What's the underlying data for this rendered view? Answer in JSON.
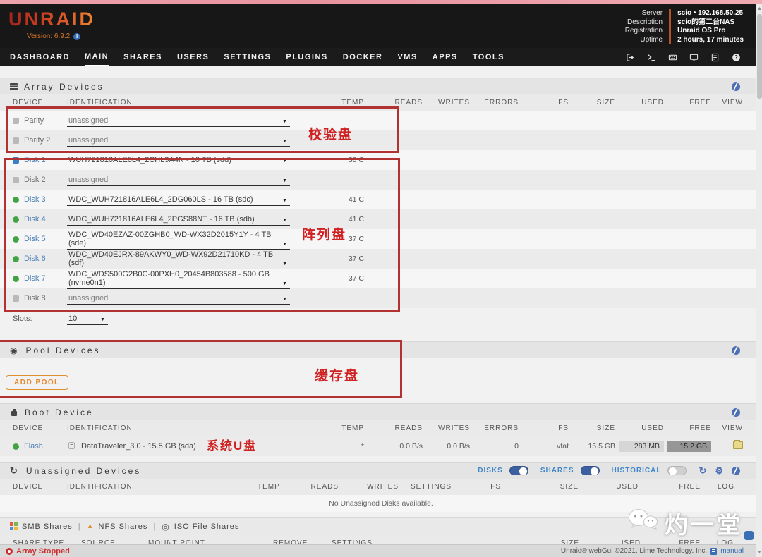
{
  "header": {
    "logo": "UNRAID",
    "version_label": "Version: 6.9.2",
    "info_rows": [
      {
        "label": "Server",
        "value": "scio • 192.168.50.25"
      },
      {
        "label": "Description",
        "value": "scio的第二台NAS"
      },
      {
        "label": "Registration",
        "value": "Unraid OS Pro"
      },
      {
        "label": "Uptime",
        "value": "2 hours, 17 minutes"
      }
    ]
  },
  "nav": {
    "items": [
      "DASHBOARD",
      "MAIN",
      "SHARES",
      "USERS",
      "SETTINGS",
      "PLUGINS",
      "DOCKER",
      "VMS",
      "APPS",
      "TOOLS"
    ],
    "active": "MAIN",
    "icon_names": [
      "logout-icon",
      "terminal-icon",
      "keyboard-icon",
      "display-icon",
      "log-icon",
      "help-icon"
    ]
  },
  "array": {
    "title": "Array Devices",
    "columns": [
      "DEVICE",
      "IDENTIFICATION",
      "TEMP",
      "READS",
      "WRITES",
      "ERRORS",
      "FS",
      "SIZE",
      "USED",
      "FREE",
      "VIEW"
    ],
    "rows": [
      {
        "status": "unassigned",
        "device": "Parity",
        "identification": "unassigned",
        "temp": ""
      },
      {
        "status": "unassigned",
        "device": "Parity 2",
        "identification": "unassigned",
        "temp": ""
      },
      {
        "status": "new",
        "device": "Disk 1",
        "identification": "WUH721816ALE6L4_2CHL9A4N - 16 TB (sdd)",
        "temp": "38 C"
      },
      {
        "status": "unassigned",
        "device": "Disk 2",
        "identification": "unassigned",
        "temp": ""
      },
      {
        "status": "active",
        "device": "Disk 3",
        "identification": "WDC_WUH721816ALE6L4_2DG060LS - 16 TB (sdc)",
        "temp": "41 C"
      },
      {
        "status": "active",
        "device": "Disk 4",
        "identification": "WDC_WUH721816ALE6L4_2PGS88NT - 16 TB (sdb)",
        "temp": "41 C"
      },
      {
        "status": "active",
        "device": "Disk 5",
        "identification": "WDC_WD40EZAZ-00ZGHB0_WD-WX32D2015Y1Y - 4 TB (sde)",
        "temp": "37 C"
      },
      {
        "status": "active",
        "device": "Disk 6",
        "identification": "WDC_WD40EJRX-89AKWY0_WD-WX92D21710KD - 4 TB (sdf)",
        "temp": "37 C"
      },
      {
        "status": "active",
        "device": "Disk 7",
        "identification": "WDC_WDS500G2B0C-00PXH0_20454B803588 - 500 GB (nvme0n1)",
        "temp": "37 C"
      },
      {
        "status": "unassigned",
        "device": "Disk 8",
        "identification": "unassigned",
        "temp": ""
      }
    ],
    "slots_label": "Slots:",
    "slots_value": "10"
  },
  "annotations": {
    "parity": "校验盘",
    "array": "阵列盘",
    "cache": "缓存盘",
    "boot": "系统U盘"
  },
  "pool": {
    "title": "Pool Devices",
    "add_button": "ADD POOL"
  },
  "boot": {
    "title": "Boot Device",
    "row": {
      "status": "active",
      "device": "Flash",
      "identification": "DataTraveler_3.0 - 15.5 GB (sda)",
      "temp": "*",
      "reads": "0.0 B/s",
      "writes": "0.0 B/s",
      "errors": "0",
      "fs": "vfat",
      "size": "15.5 GB",
      "used": "283 MB",
      "free": "15.2 GB"
    }
  },
  "unassigned": {
    "title": "Unassigned Devices",
    "toggles": [
      {
        "label": "DISKS",
        "on": true
      },
      {
        "label": "SHARES",
        "on": true
      },
      {
        "label": "HISTORICAL",
        "on": false
      }
    ],
    "columns": [
      "DEVICE",
      "IDENTIFICATION",
      "TEMP",
      "READS",
      "WRITES",
      "SETTINGS",
      "FS",
      "SIZE",
      "USED",
      "FREE",
      "LOG"
    ],
    "empty": "No Unassigned Disks available."
  },
  "shares": {
    "tabs": [
      "SMB Shares",
      "NFS Shares",
      "ISO File Shares"
    ],
    "columns": [
      "SHARE TYPE",
      "SOURCE",
      "MOUNT POINT",
      "REMOVE",
      "SETTINGS",
      "SIZE",
      "USED",
      "FREE",
      "LOG"
    ]
  },
  "footer": {
    "status": "Array Stopped",
    "copyright": "Unraid® webGui ©2021, Lime Technology, Inc.",
    "manual": "manual"
  },
  "watermark": "灼一堂",
  "colors": {
    "accent_orange": "#e8862b",
    "link_blue": "#4a7fb5",
    "toggle_blue": "#3b5fa0",
    "annotation_red": "#cf2121",
    "active_green": "#41a344",
    "new_blue": "#3d7fc4"
  }
}
